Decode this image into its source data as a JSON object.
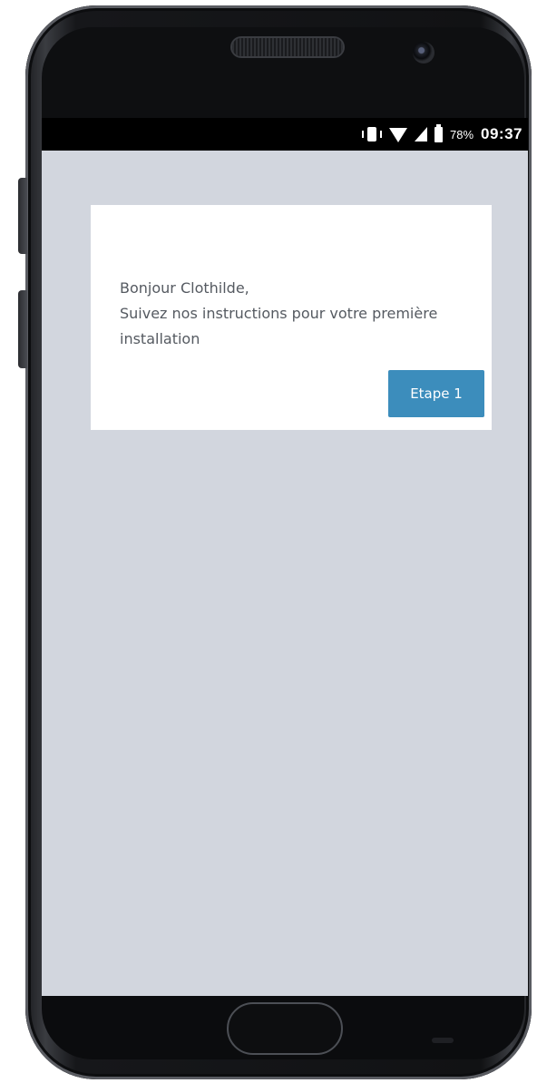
{
  "status_bar": {
    "battery_percent": "78%",
    "time": "09:37",
    "icons": [
      "vibrate-icon",
      "wifi-icon",
      "signal-icon",
      "battery-icon"
    ]
  },
  "card": {
    "greeting_line1": "Bonjour Clothilde,",
    "greeting_line2": "Suivez nos instructions pour votre première",
    "greeting_line3": "installation",
    "button_label": "Etape 1"
  },
  "colors": {
    "screen_background": "#d2d6de",
    "card_background": "#ffffff",
    "button_background": "#3c8dbc",
    "button_text": "#ffffff",
    "status_bar_background": "#000000"
  }
}
